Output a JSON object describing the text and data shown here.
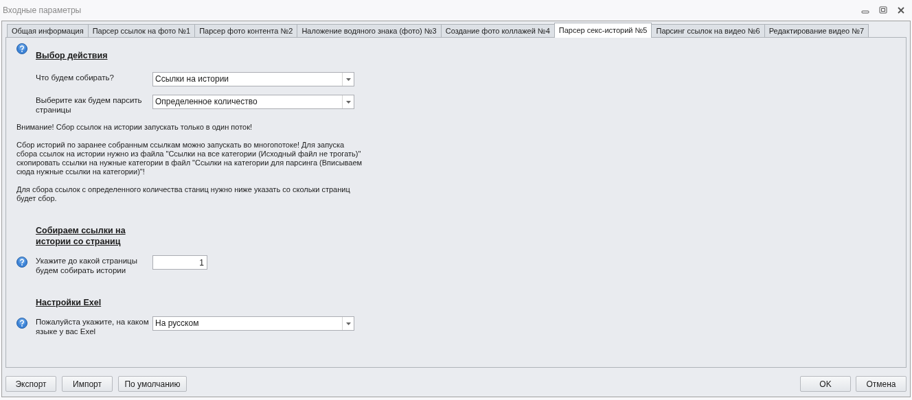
{
  "window": {
    "title": "Входные параметры"
  },
  "tabs": [
    {
      "label": "Общая информация",
      "selected": false
    },
    {
      "label": "Парсер ссылок на фото №1",
      "selected": false
    },
    {
      "label": "Парсер фото контента №2",
      "selected": false
    },
    {
      "label": "Наложение водяного знака (фото) №3",
      "selected": false
    },
    {
      "label": "Создание фото коллажей №4",
      "selected": false
    },
    {
      "label": "Парсер секс-историй №5",
      "selected": true
    },
    {
      "label": "Парсинг ссылок на видео №6",
      "selected": false
    },
    {
      "label": "Редактирование видео №7",
      "selected": false
    }
  ],
  "content": [
    {
      "kind": "heading",
      "text": "Выбор действия",
      "help": true
    },
    {
      "kind": "select",
      "label": "Что будем собирать?",
      "value": "Ссылки на истории",
      "help": false
    },
    {
      "kind": "select",
      "label": "Выберите как будем парсить страницы",
      "value": "Определенное количество",
      "help": false
    },
    {
      "kind": "paragraph",
      "text": "Внимание! Сбор ссылок на истории запускать только в один поток!"
    },
    {
      "kind": "paragraph",
      "text": "Сбор историй по заранее собранным ссылкам можно запускать во многопотоке! Для запуска сбора ссылок на истории нужно из файла \"Ссылки на все категории (Исходный файл не трогать)\" скопировать ссылки на нужные категории в файл \"Ссылки на категории для парсинга (Вписываем сюда нужные ссылки на категории)\"!"
    },
    {
      "kind": "paragraph",
      "text": "Для сбора ссылок с определенного количества станиц нужно ниже указать со скольки страниц будет сбор."
    },
    {
      "kind": "heading",
      "text": "Собираем ссылки на истории со страниц",
      "help": false
    },
    {
      "kind": "number",
      "label": "Укажите до какой страницы будем собирать истории",
      "value": "1",
      "help": true
    },
    {
      "kind": "heading",
      "text": "Настройки Exel",
      "help": false
    },
    {
      "kind": "select",
      "label": "Пожалуйста укажите, на каком языке у вас Exel",
      "value": "На русском",
      "help": true
    }
  ],
  "buttons_left": [
    "Экспорт",
    "Импорт",
    "По умолчанию"
  ],
  "buttons_right": [
    "OK",
    "Отмена"
  ]
}
